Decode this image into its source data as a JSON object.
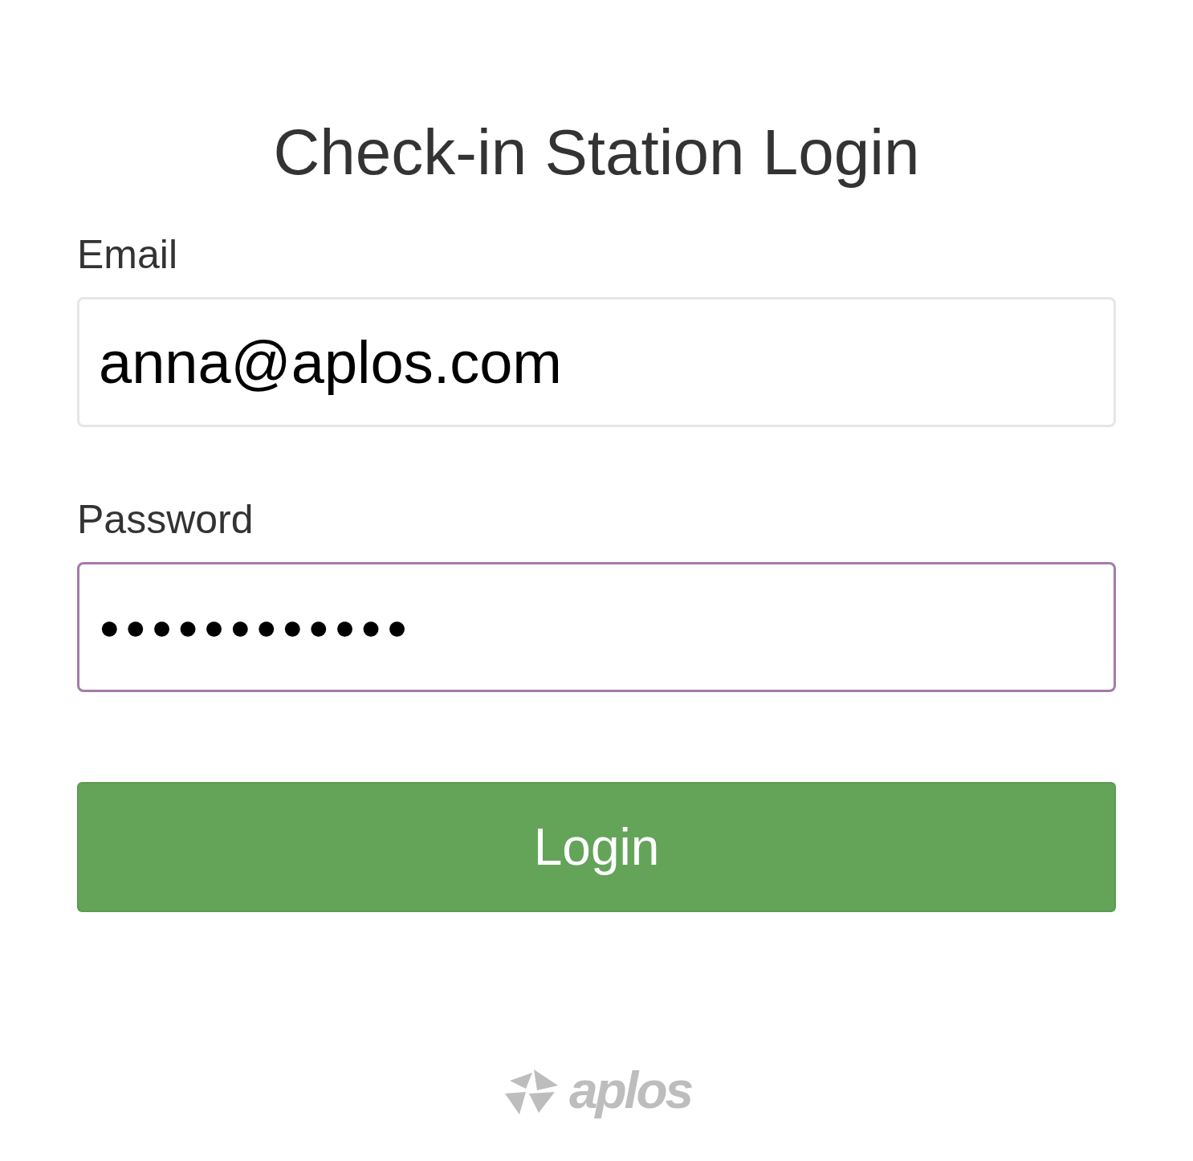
{
  "title": "Check-in Station Login",
  "fields": [
    {
      "label": "Email",
      "value": "anna@aplos.com",
      "focused": false,
      "kind": "text"
    },
    {
      "label": "Password",
      "value": "●●●●●●●●●●●●",
      "focused": true,
      "kind": "masked"
    }
  ],
  "button": {
    "label": "Login"
  },
  "logo": {
    "text": "aplos"
  }
}
